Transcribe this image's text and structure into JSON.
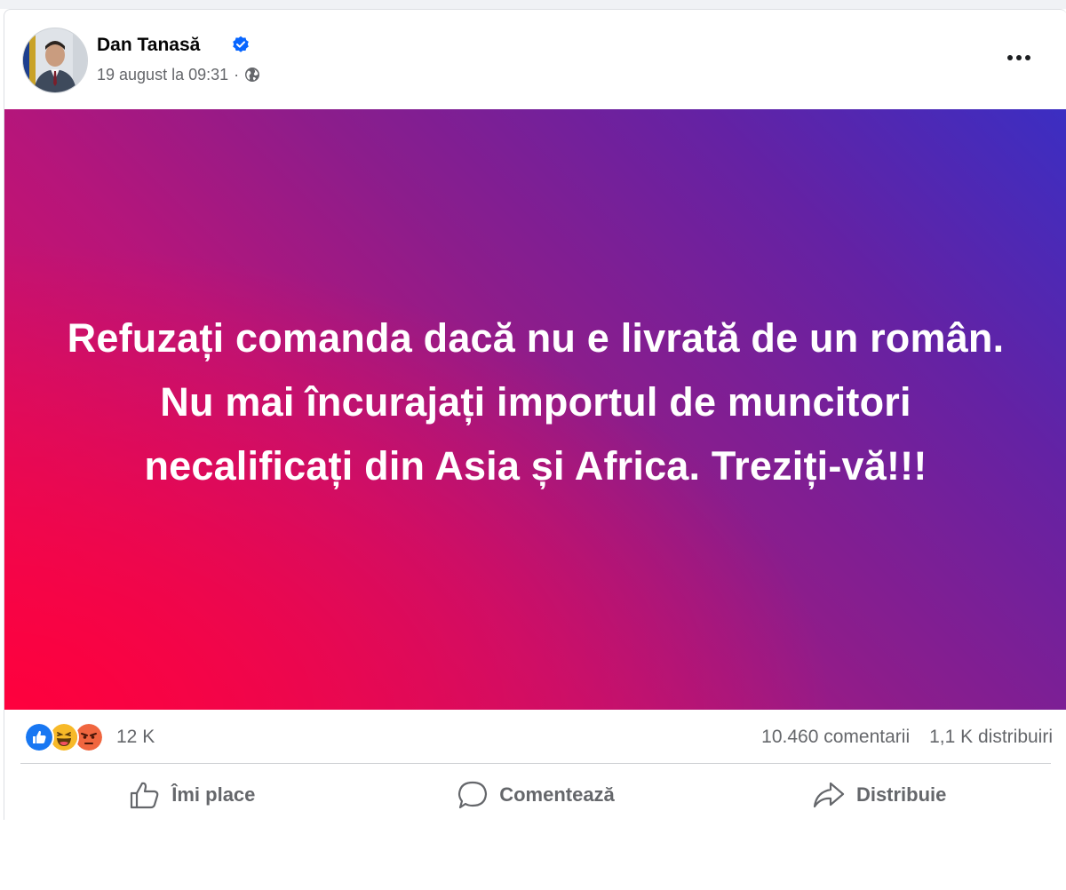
{
  "post": {
    "author": "Dan Tanasă",
    "timestamp": "19 august la 09:31",
    "separator": "·",
    "banner_text": "Refuzați comanda dacă nu e livrată de un român. Nu mai încurajați importul de muncitori necalificați din Asia și Africa. Treziți-vă!!!",
    "banner_colors": [
      "#ee0a55",
      "#8b1d8c",
      "#3b2ec2"
    ]
  },
  "stats": {
    "reactions": [
      "like-icon",
      "haha-icon",
      "angry-icon"
    ],
    "reaction_count": "12 K",
    "comments": "10.460 comentarii",
    "shares": "1,1 K distribuiri"
  },
  "actions": {
    "like": "Îmi place",
    "comment": "Comentează",
    "share": "Distribuie"
  },
  "icons": {
    "verified": "verified-badge-icon",
    "privacy": "globe-icon",
    "more": "more-options-icon"
  }
}
